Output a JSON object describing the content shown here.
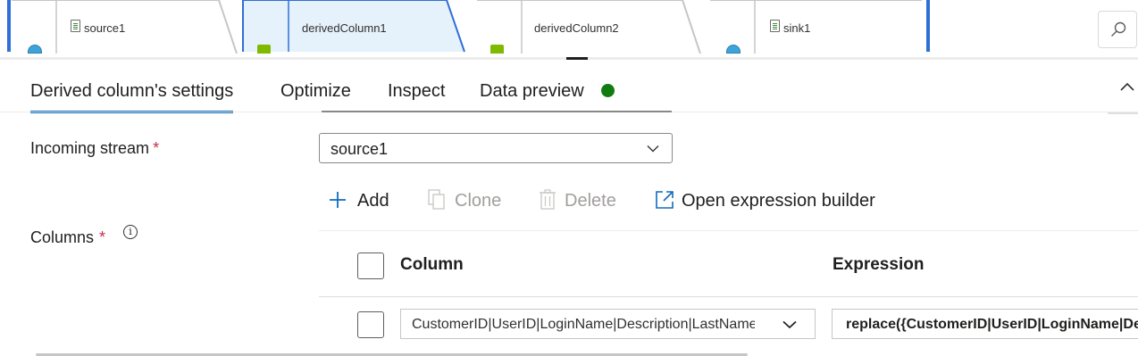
{
  "canvas": {
    "nodes": [
      {
        "label": "source1",
        "icon": "database-icon"
      },
      {
        "label": "derivedColumn1",
        "icon": "transform-icon",
        "selected": true
      },
      {
        "label": "derivedColumn2",
        "icon": "transform-icon"
      },
      {
        "label": "sink1",
        "icon": "database-icon"
      }
    ]
  },
  "tabs": [
    {
      "label": "Derived column's settings",
      "active": true
    },
    {
      "label": "Optimize"
    },
    {
      "label": "Inspect"
    },
    {
      "label": "Data preview"
    }
  ],
  "status_color": "#107c10",
  "form": {
    "incoming_stream_label": "Incoming stream",
    "columns_label": "Columns",
    "required_mark": "*",
    "info_glyph": "i",
    "incoming_stream_value": "source1"
  },
  "toolbar": {
    "add": "Add",
    "clone": "Clone",
    "delete": "Delete",
    "open_builder": "Open expression builder"
  },
  "grid": {
    "headers": [
      "Column",
      "Expression"
    ],
    "rows": [
      {
        "column": "CustomerID|UserID|LoginName|Description|LastName",
        "expression": "replace({CustomerID|UserID|LoginName|Description|LastName}"
      }
    ]
  },
  "accent": "#0f6cbd"
}
